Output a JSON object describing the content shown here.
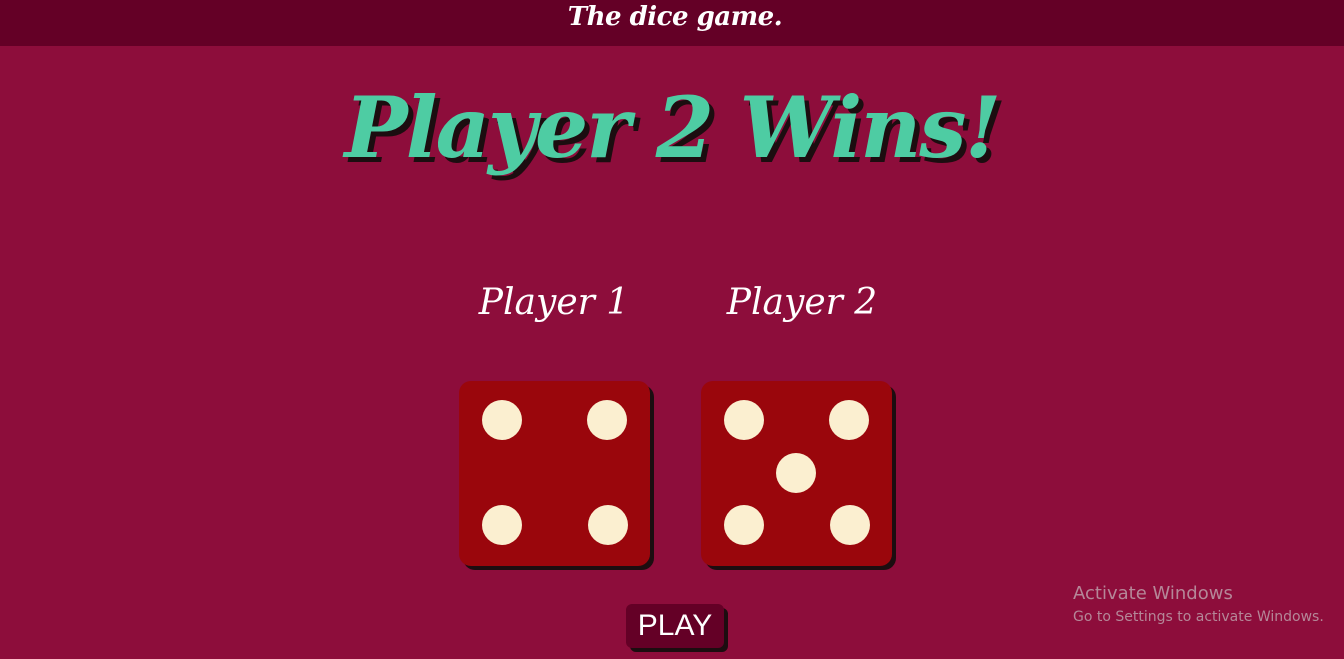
{
  "header": {
    "title": "The dice game."
  },
  "result": {
    "message": "Player 2 Wins!"
  },
  "players": [
    {
      "label": "Player 1",
      "die_value": 4
    },
    {
      "label": "Player 2",
      "die_value": 5
    }
  ],
  "controls": {
    "play_label": "PLAY"
  },
  "windows_watermark": {
    "title": "Activate Windows",
    "subtitle": "Go to Settings to activate Windows."
  },
  "colors": {
    "background": "#8d0d3b",
    "header_bar": "#640026",
    "winner_text": "#4ecca3",
    "die_face": "#9a060c",
    "pip": "#fbefd0"
  }
}
